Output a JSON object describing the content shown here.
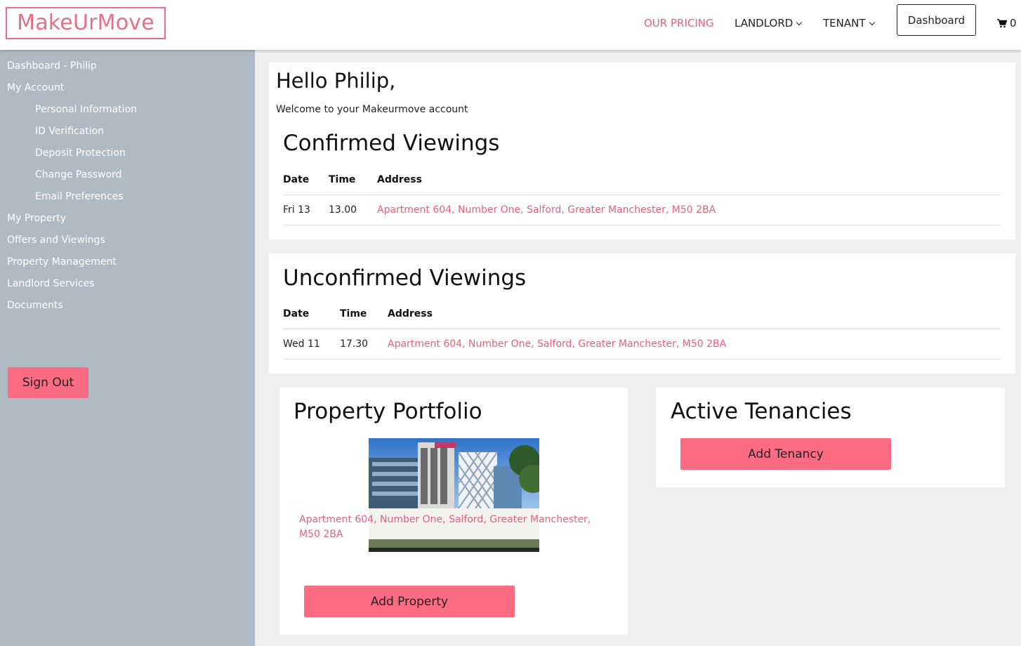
{
  "header": {
    "logo": "MakeUrMove",
    "nav": {
      "pricing": "OUR PRICING",
      "landlord": "LANDLORD",
      "tenant": "TENANT",
      "dashboard": "Dashboard",
      "cart_count": "0"
    }
  },
  "sidebar": {
    "items": [
      "Dashboard - Philip",
      "My Account",
      "Personal Information",
      "ID Verification",
      "Deposit Protection",
      "Change Password",
      "Email Preferences",
      "My Property",
      "Offers and Viewings",
      "Property Management",
      "Landlord Services",
      "Documents"
    ],
    "sign_out": "Sign Out"
  },
  "greeting": {
    "title": "Hello Philip,",
    "subtitle": "Welcome to your Makeurmove account"
  },
  "confirmed": {
    "title": "Confirmed Viewings",
    "headers": [
      "Date",
      "Time",
      "Address"
    ],
    "rows": [
      {
        "date": "Fri 13",
        "time": "13.00",
        "address": "Apartment 604, Number One, Salford, Greater Manchester, M50 2BA"
      }
    ]
  },
  "unconfirmed": {
    "title": "Unconfirmed Viewings",
    "headers": [
      "Date",
      "Time",
      "Address"
    ],
    "rows": [
      {
        "date": "Wed 11",
        "time": "17.30",
        "address": "Apartment 604, Number One, Salford, Greater Manchester, M50 2BA"
      }
    ]
  },
  "portfolio": {
    "title": "Property Portfolio",
    "address": "Apartment 604, Number One, Salford, Greater Manchester, M50 2BA",
    "add_button": "Add Property"
  },
  "tenancies": {
    "title": "Active Tenancies",
    "add_button": "Add Tenancy"
  },
  "colors": {
    "brand_pink": "#e9607a",
    "button_pink": "#fd6b82",
    "sidebar_bg": "#b0bac4"
  }
}
